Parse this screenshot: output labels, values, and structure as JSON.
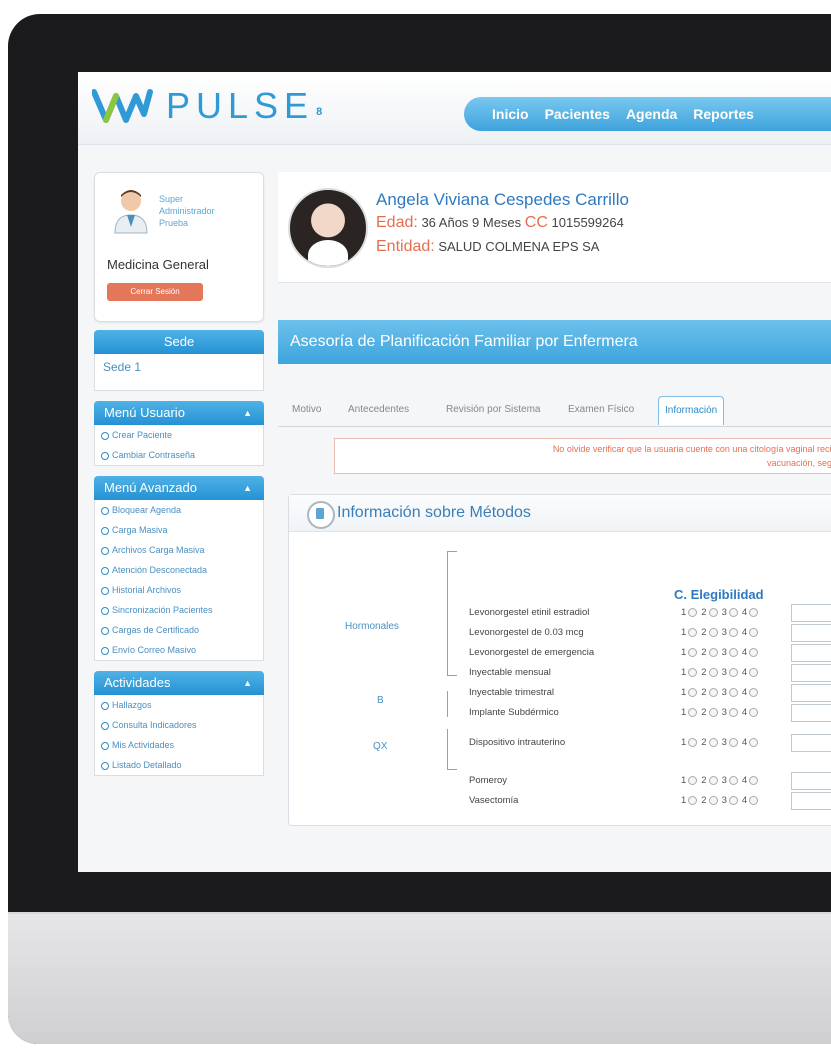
{
  "header": {
    "logo_text": "PULSE",
    "logo_version": "8",
    "nav": [
      "Inicio",
      "Pacientes",
      "Agenda",
      "Reportes"
    ]
  },
  "user": {
    "name_lines": [
      "Super",
      "Administrador",
      "Prueba"
    ],
    "specialty": "Medicina General",
    "logout_label": "Cerrar Sesión"
  },
  "sede": {
    "title": "Sede",
    "value": "Sede 1"
  },
  "menus": [
    {
      "title": "Menú Usuario",
      "items": [
        "Crear Paciente",
        "Cambiar Contraseña"
      ]
    },
    {
      "title": "Menú Avanzado",
      "items": [
        "Bloquear Agenda",
        "Carga Masiva",
        "Archivos Carga Masiva",
        "Atención Desconectada",
        "Historial Archivos",
        "Sincronización Pacientes",
        "Cargas de Certificado",
        "Envío Correo Masivo"
      ]
    },
    {
      "title": "Actividades",
      "items": [
        "Hallazgos",
        "Consulta Indicadores",
        "Mis Actividades",
        "Listado Detallado"
      ]
    }
  ],
  "patient": {
    "name": "Angela Viviana Cespedes Carrillo",
    "age_label": "Edad:",
    "age": "36 Años 9 Meses",
    "id_label": "CC",
    "id": "1015599264",
    "entity_label": "Entidad:",
    "entity": "SALUD COLMENA EPS SA"
  },
  "section_title": "Asesoría de Planificación Familiar por Enfermera",
  "tabs": [
    "Motivo",
    "Antecedentes",
    "Revisión por Sistema",
    "Examen Físico",
    "Información"
  ],
  "alert": {
    "line1": "No olvide verificar que la usuaria cuente con una citología vaginal reciente",
    "line2": "vacunación, según s"
  },
  "methods": {
    "title": "Información sobre Métodos",
    "eligibility_title": "C. Elegibilidad",
    "option_labels": [
      "1",
      "2",
      "3",
      "4"
    ],
    "groups": [
      {
        "label": "Hormonales",
        "items": [
          "Levonorgestel etinil estradiol",
          "Levonorgestel de 0.03 mcg",
          "Levonorgestel de emergencia",
          "Inyectable mensual",
          "Inyectable trimestral",
          "Implante Subdérmico"
        ]
      },
      {
        "label": "B",
        "items": [
          "Dispositivo intrauterino"
        ]
      },
      {
        "label": "QX",
        "items": [
          "Pomeroy",
          "Vasectomía"
        ]
      }
    ]
  }
}
